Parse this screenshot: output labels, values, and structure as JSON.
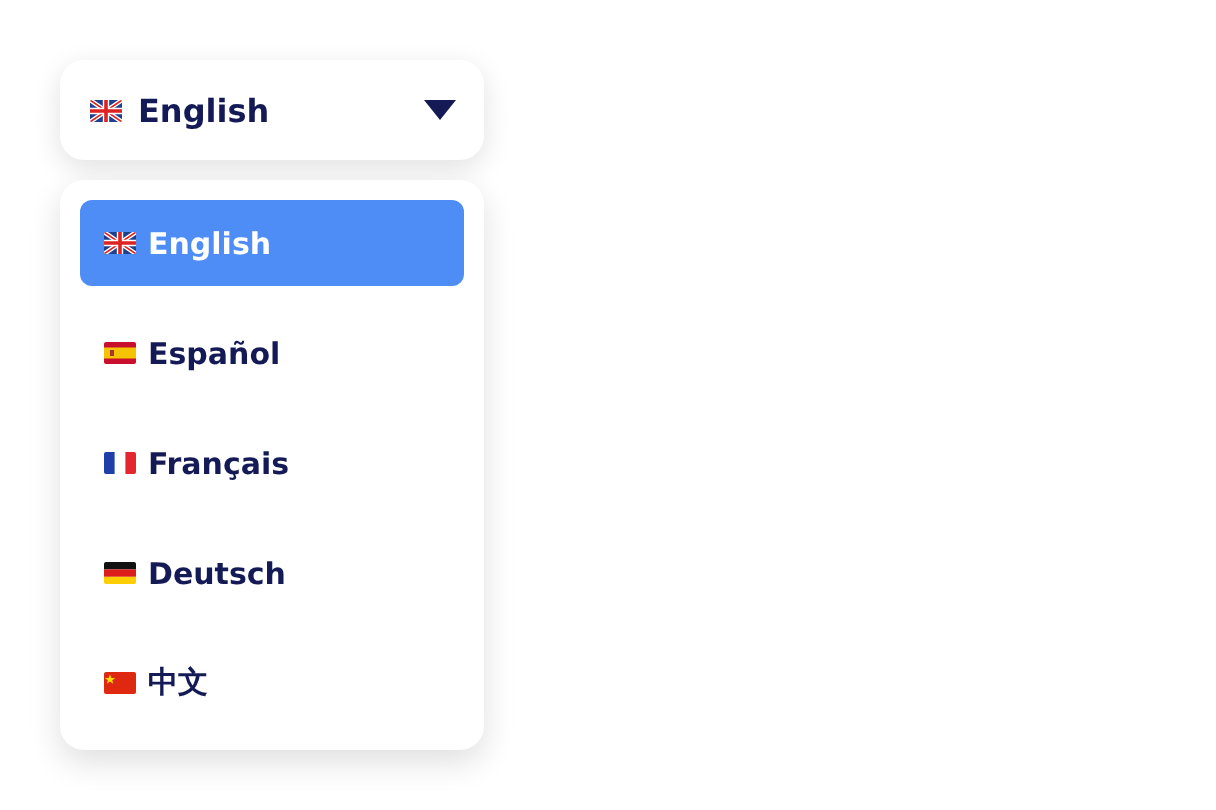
{
  "selector": {
    "label": "English",
    "kind": "gb",
    "expanded": true
  },
  "options": [
    {
      "label": "English",
      "kind": "gb",
      "selected": true
    },
    {
      "label": "Español",
      "kind": "es",
      "selected": false
    },
    {
      "label": "Français",
      "kind": "fr",
      "selected": false
    },
    {
      "label": "Deutsch",
      "kind": "de",
      "selected": false
    },
    {
      "label": "中文",
      "kind": "cn",
      "selected": false
    }
  ]
}
